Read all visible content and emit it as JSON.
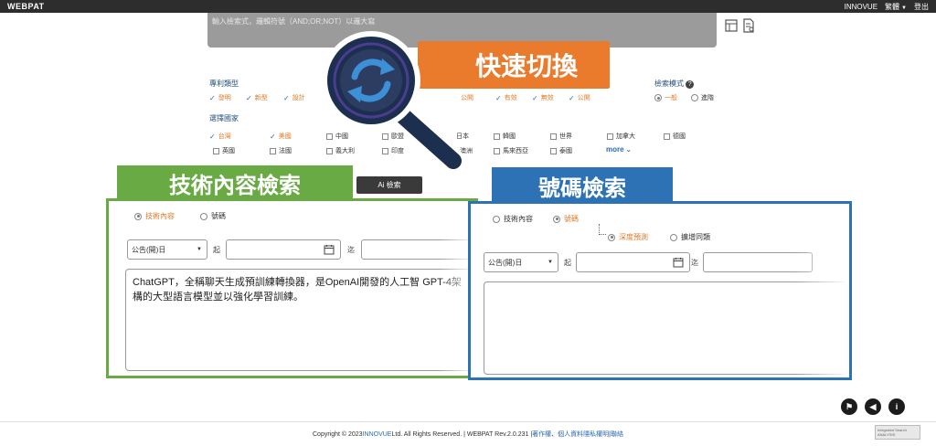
{
  "topbar": {
    "logo": "WEBPAT",
    "org": "INNOVUE",
    "lang": "繁體",
    "logout": "登出"
  },
  "search": {
    "placeholder": "輸入檢索式，邏輯符號（AND;OR;NOT）以邏大寫"
  },
  "overlay": {
    "orange_label": "快速切換",
    "green_label": "技術內容檢索",
    "blue_label": "號碼檢索"
  },
  "patent_type": {
    "title": "專利類型",
    "items": [
      {
        "label": "發明",
        "checked": true
      },
      {
        "label": "新型",
        "checked": true
      },
      {
        "label": "設計",
        "checked": true
      }
    ],
    "status_items": [
      {
        "label": "公開",
        "checked": true
      },
      {
        "label": "有效",
        "checked": true
      },
      {
        "label": "無效",
        "checked": true
      },
      {
        "label": "公開",
        "checked": true
      }
    ]
  },
  "search_mode": {
    "title": "檢索模式",
    "options": [
      "一般",
      "進階"
    ],
    "selected": "一般"
  },
  "countries": {
    "title": "選擇國家",
    "row1": [
      "台灣",
      "美國",
      "中國",
      "歐盟",
      "日本",
      "韓國",
      "世界",
      "加拿大",
      "德國"
    ],
    "row2": [
      "英國",
      "法國",
      "義大利",
      "印度",
      "澳洲",
      "馬來西亞",
      "泰國"
    ],
    "checked": [
      "台灣",
      "美國"
    ],
    "more": "more"
  },
  "ai_button": "Ai 檢索",
  "left_panel": {
    "radio_content": "技術內容",
    "radio_number": "號碼",
    "date_type": "公告(開)日",
    "from": "起",
    "to": "迄",
    "text": "ChatGPT，全稱聊天生成預訓練轉換器，是OpenAI開發的人工智 GPT-4架構的大型語言模型並以強化學習訓練。"
  },
  "right_panel": {
    "radio_content": "技術內容",
    "radio_number": "號碼",
    "deep_predict": "深度預測",
    "expand": "擴增同類",
    "date_type": "公告(開)日",
    "from": "起",
    "to": "迄"
  },
  "footer": {
    "copyright": "Copyright © 2023 ",
    "company": "INNOVUE",
    "rights": " Ltd. All Rights Reserved. | WEBPAT Rev.2.0.231 | ",
    "link1": "著作權",
    "dot": "、",
    "link2": "個人資料隱私權明",
    "pipe": " | ",
    "link3": "聯絡"
  },
  "badge": {
    "line1": "Integrated Search",
    "line2": "ANALYSIS"
  },
  "colors": {
    "green": "#6aaa45",
    "blue": "#2e72b6",
    "orange": "#ea7a2c",
    "topbar": "#2d2d2d"
  }
}
